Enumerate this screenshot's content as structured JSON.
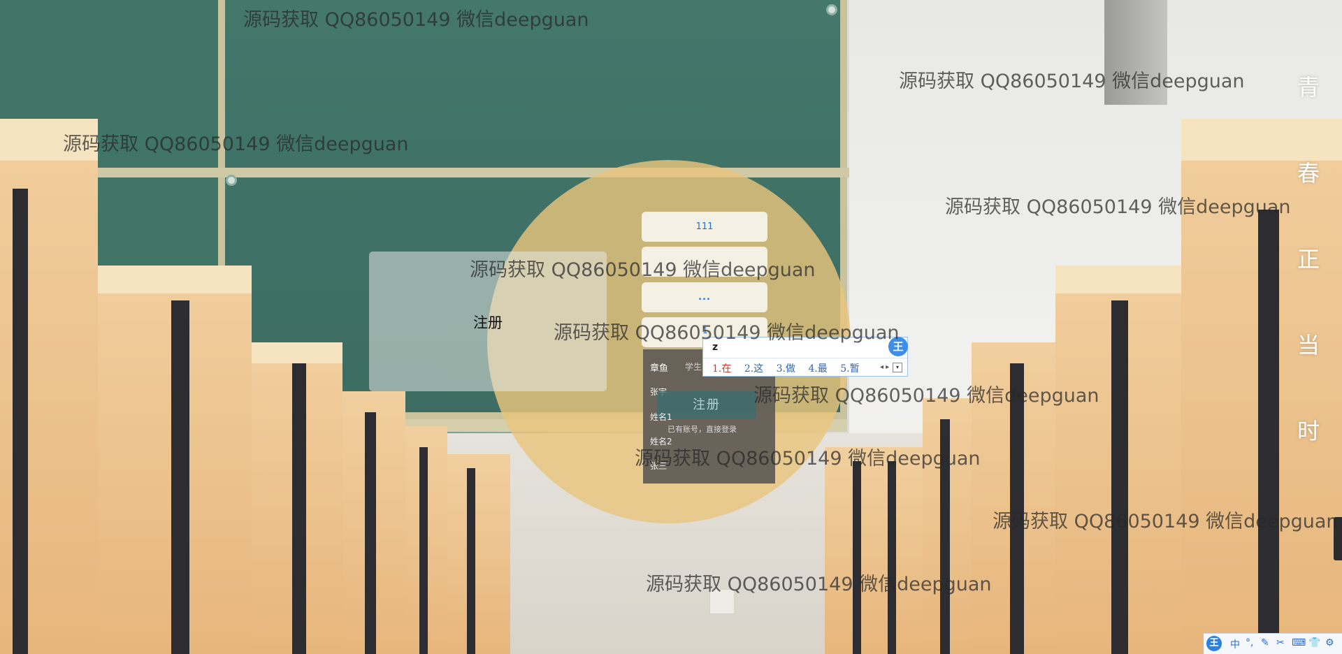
{
  "form": {
    "title": "注册",
    "field1_value": "111",
    "field2_value": "",
    "field3_value": "...",
    "field4_value": "",
    "dropdown": {
      "header": "章鱼",
      "header2": "学生",
      "items": [
        "张宇",
        "姓名1",
        "姓名2",
        "张三"
      ]
    },
    "register_button": "注册",
    "login_link": "已有账号，直接登录"
  },
  "side_title": [
    "青",
    "春",
    "正",
    "当",
    "时"
  ],
  "watermark_text": "源码获取 QQ86050149 微信deepguan",
  "ime": {
    "input": "z",
    "candidates": [
      "1.在",
      "2.这",
      "3.做",
      "4.最",
      "5.暂"
    ],
    "logo": "王",
    "nav": "◂ ▸",
    "more": "▾",
    "marker": "1"
  },
  "ime_toolbar": {
    "logo": "王",
    "icons": [
      "中",
      "°,",
      "✎",
      "✂",
      "⌨",
      "👕",
      "⚙"
    ]
  }
}
